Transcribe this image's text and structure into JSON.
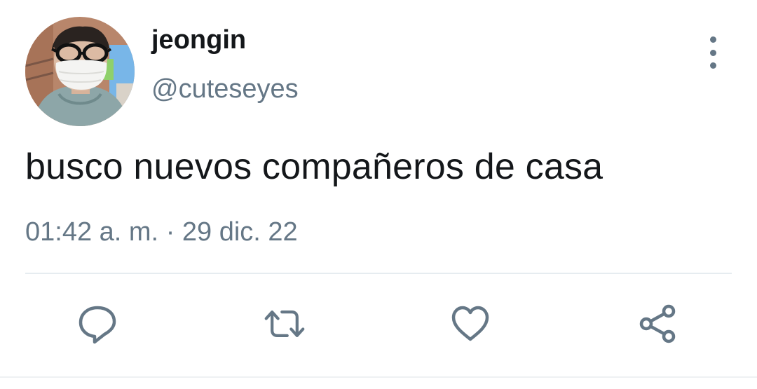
{
  "tweet": {
    "author": {
      "display_name": "jeongin",
      "handle": "@cuteseyes"
    },
    "text": "busco nuevos compañeros de casa",
    "time": "01:42 a. m.",
    "separator": "·",
    "date": "29 dic. 22"
  },
  "icons": {
    "more": "more-vertical-icon",
    "reply": "reply-icon",
    "retweet": "retweet-icon",
    "like": "heart-icon",
    "share": "share-icon"
  },
  "colors": {
    "text_primary": "#14171a",
    "text_secondary": "#657786",
    "divider": "#e6ecf0",
    "background": "#ffffff"
  }
}
